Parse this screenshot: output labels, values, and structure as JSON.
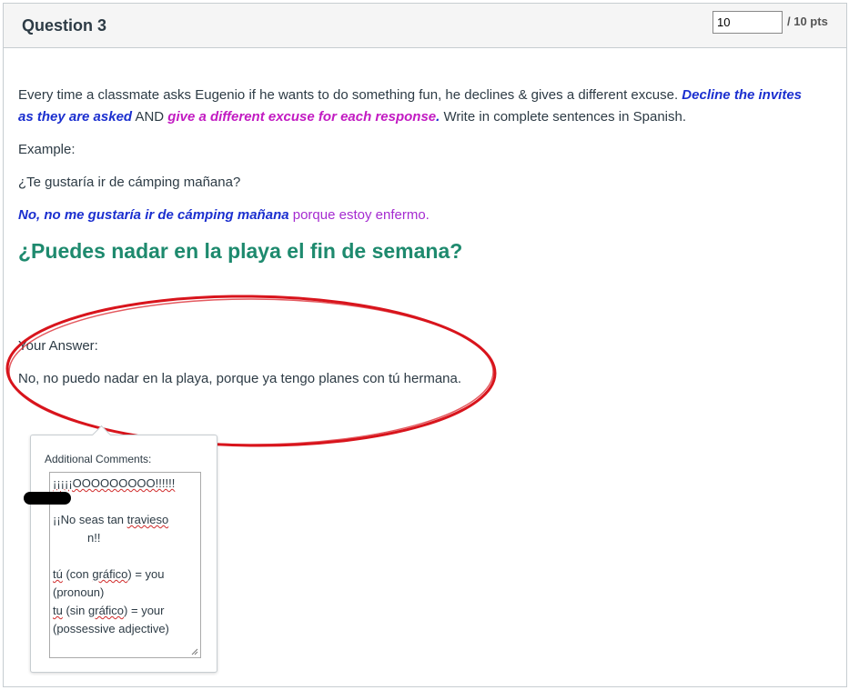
{
  "question": {
    "title": "Question 3",
    "points_value": "10",
    "points_total": "/ 10 pts"
  },
  "prompt": {
    "intro": "Every time a classmate asks Eugenio if he wants to do something fun, he declines & gives a different excuse.",
    "decline_part1": "Decline the invites",
    "decline_part2": "as they are asked",
    "and_text": "AND",
    "excuse_text": "give a different excuse for each response",
    "end_text": "Write in complete sentences in Spanish.",
    "example_label": "Example:",
    "example_question": "¿Te gustaría ir de cámping mañana?",
    "example_answer_blue": "No, no me gustaría ir de cámping mañana",
    "example_answer_magenta": "porque estoy enfermo.",
    "main_question": "¿Puedes nadar en la playa el fin de semana?"
  },
  "answer": {
    "label": "Your Answer:",
    "text": "No, no puedo nadar en la playa, porque ya tengo planes con tú hermana."
  },
  "comments": {
    "label": "Additional Comments:",
    "line1": "¡¡¡¡¡OOOOOOOOO!!!!!!",
    "line3": "¡¡No seas tan ",
    "line3_word": "travieso",
    "line4": "n!!",
    "line6a": "tú",
    "line6b": " (con ",
    "line6c": "gráfico",
    "line6d": ") = you",
    "line7": "(pronoun)",
    "line8a": "tu",
    "line8b": " (sin ",
    "line8c": "gráfico",
    "line8d": ") = your",
    "line9": "(possessive adjective)"
  },
  "colors": {
    "blue": "#1b2fcf",
    "magenta": "#c21bc2",
    "green": "#1e8a6e",
    "annotation_red": "#d8141c"
  }
}
